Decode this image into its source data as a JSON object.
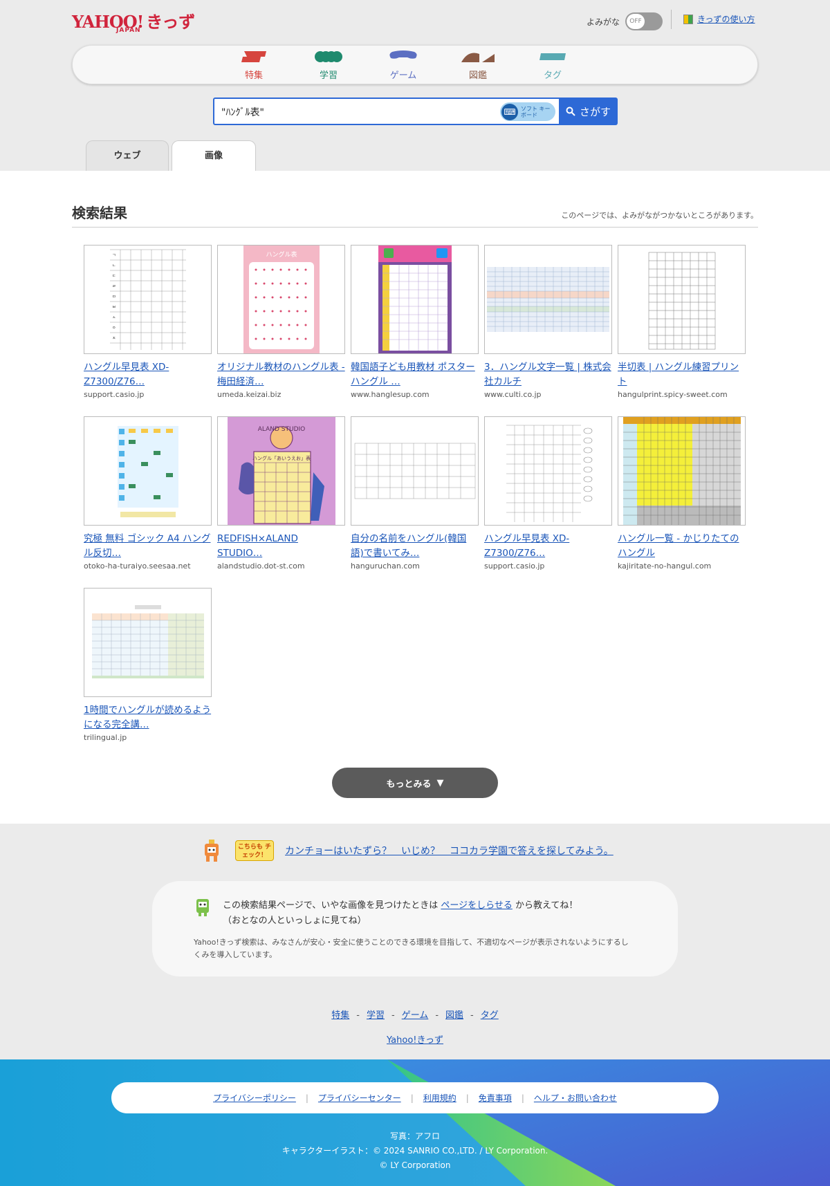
{
  "header": {
    "logo_yahoo": "YAHOO!",
    "logo_japan": "JAPAN",
    "logo_kids": "きっず",
    "yomigana_label": "よみがな",
    "toggle_state": "OFF",
    "howto_link": "きっずの使い方",
    "nav": [
      {
        "label": "特集",
        "icon": "feature-icon",
        "color": "#d6453e"
      },
      {
        "label": "学習",
        "icon": "study-icon",
        "color": "#1f8a6e"
      },
      {
        "label": "ゲーム",
        "icon": "game-icon",
        "color": "#5c6fc2"
      },
      {
        "label": "図鑑",
        "icon": "encyclopedia-icon",
        "color": "#8a5a45"
      },
      {
        "label": "タグ",
        "icon": "tag-icon",
        "color": "#58a9b2"
      }
    ]
  },
  "search": {
    "query": "\"ﾊﾝｸﾞﾙ表\"",
    "softkb_label": "ソフト キーボード",
    "button_label": "さがす"
  },
  "tabs": [
    {
      "label": "ウェブ",
      "active": false
    },
    {
      "label": "画像",
      "active": true
    }
  ],
  "results": {
    "title": "検索結果",
    "note": "このページでは、よみがながつかないところがあります。",
    "items": [
      {
        "title": "ハングル早見表 XD-Z7300/Z76…",
        "domain": "support.casio.jp"
      },
      {
        "title": "オリジナル教材のハングル表 - 梅田経済…",
        "domain": "umeda.keizai.biz"
      },
      {
        "title": "韓国語子ども用教材 ポスター ハングル …",
        "domain": "www.hanglesup.com"
      },
      {
        "title": "3．ハングル文字一覧 | 株式会社カルチ",
        "domain": "www.culti.co.jp"
      },
      {
        "title": "半切表 | ハングル練習プリント",
        "domain": "hangulprint.spicy-sweet.com"
      },
      {
        "title": "究極 無料 ゴシック A4 ハングル反切…",
        "domain": "otoko-ha-turaiyo.seesaa.net"
      },
      {
        "title": "REDFISH×ALAND STUDIO…",
        "domain": "alandstudio.dot-st.com"
      },
      {
        "title": "自分の名前をハングル(韓国語)で書いてみ…",
        "domain": "hanguruchan.com"
      },
      {
        "title": "ハングル早見表 XD-Z7300/Z76…",
        "domain": "support.casio.jp"
      },
      {
        "title": "ハングル一覧 - かじりたてのハングル",
        "domain": "kajiritate-no-hangul.com"
      },
      {
        "title": "1時間でハングルが読めるようになる完全講…",
        "domain": "trilingual.jp"
      }
    ],
    "thumb_texts": {
      "pink_title": "ハングル表",
      "aland_logo": "ALAND STUDIO",
      "aland_heading": "ハングル「あいうえお」表"
    },
    "more_label": "もっとみる"
  },
  "check": {
    "badge": "こちらも チェック！",
    "link": "カンチョーはいたずら？　いじめ？　ココカラ学園で答えを探してみよう。"
  },
  "notice": {
    "line1_pre": "この検索結果ページで、いやな画像を見つけたときは",
    "line1_link": "ページをしらせる",
    "line1_post": "から教えてね！",
    "line2": "（おとなの人といっしょに見てね）",
    "desc": "Yahoo!きっず検索は、みなさんが安心・安全に使うことのできる環境を目指して、不適切なページが表示されないようにするしくみを導入しています。"
  },
  "footnav": [
    "特集",
    "学習",
    "ゲーム",
    "図鑑",
    "タグ"
  ],
  "foothome": "Yahoo!きっず",
  "footer": {
    "links": [
      "プライバシーポリシー",
      "プライバシーセンター",
      "利用規約",
      "免責事項",
      "ヘルプ・お問い合わせ"
    ],
    "credit_photo": "写真：アフロ",
    "credit_char": "キャラクターイラスト：© 2024 SANRIO CO.,LTD. / LY Corporation.",
    "copyright": "© LY Corporation"
  }
}
